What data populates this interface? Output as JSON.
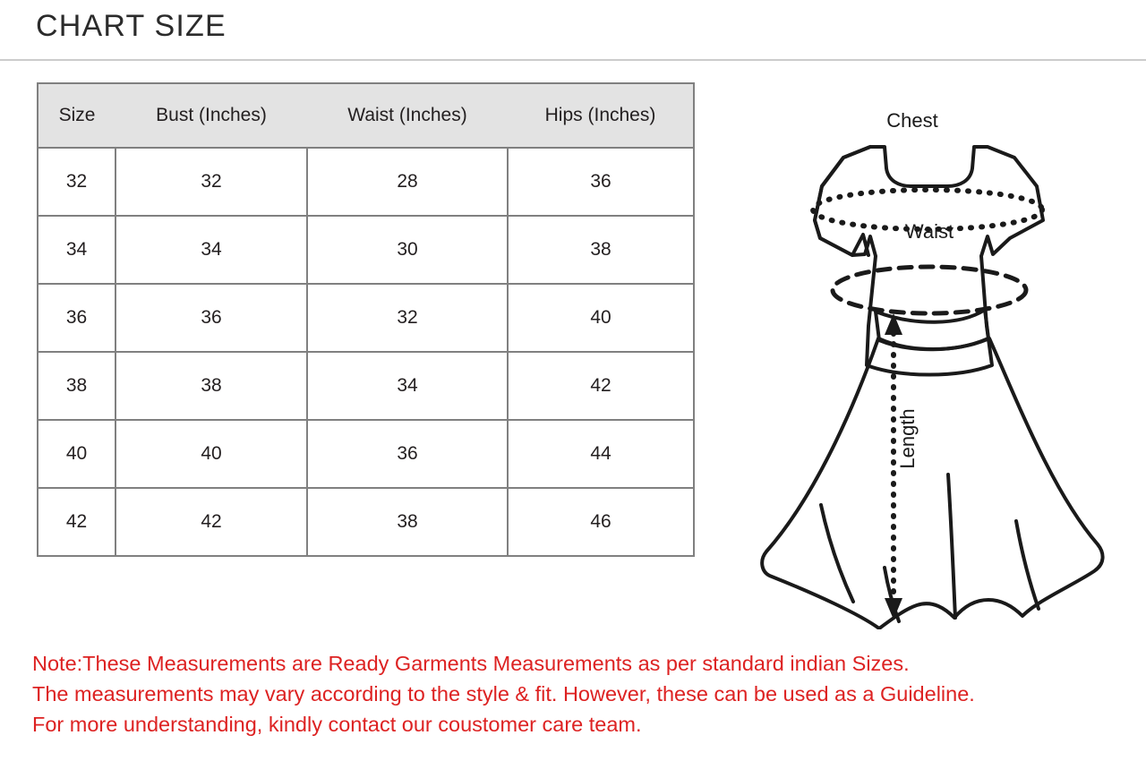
{
  "page": {
    "title": "CHART SIZE",
    "accent_red": "#dd2222",
    "border_gray": "#808080",
    "header_fill": "#e3e3e3"
  },
  "table": {
    "columns": [
      "Size",
      "Bust (Inches)",
      "Waist (Inches)",
      "Hips (Inches)"
    ],
    "rows": [
      {
        "size": "32",
        "bust": "32",
        "waist": "28",
        "hips": "36"
      },
      {
        "size": "34",
        "bust": "34",
        "waist": "30",
        "hips": "38"
      },
      {
        "size": "36",
        "bust": "36",
        "waist": "32",
        "hips": "40"
      },
      {
        "size": "38",
        "bust": "38",
        "waist": "34",
        "hips": "42"
      },
      {
        "size": "40",
        "bust": "40",
        "waist": "36",
        "hips": "44"
      },
      {
        "size": "42",
        "bust": "42",
        "waist": "38",
        "hips": "46"
      }
    ]
  },
  "illustration": {
    "labels": {
      "chest": "Chest",
      "waist": "Waist",
      "length": "Length"
    }
  },
  "notes": {
    "line1": "Note:These Measurements are Ready Garments Measurements as per standard indian Sizes.",
    "line2": "The measurements may vary according to the style & fit. However, these can be used as a Guideline.",
    "line3": "For more understanding, kindly contact our coustomer care team."
  }
}
